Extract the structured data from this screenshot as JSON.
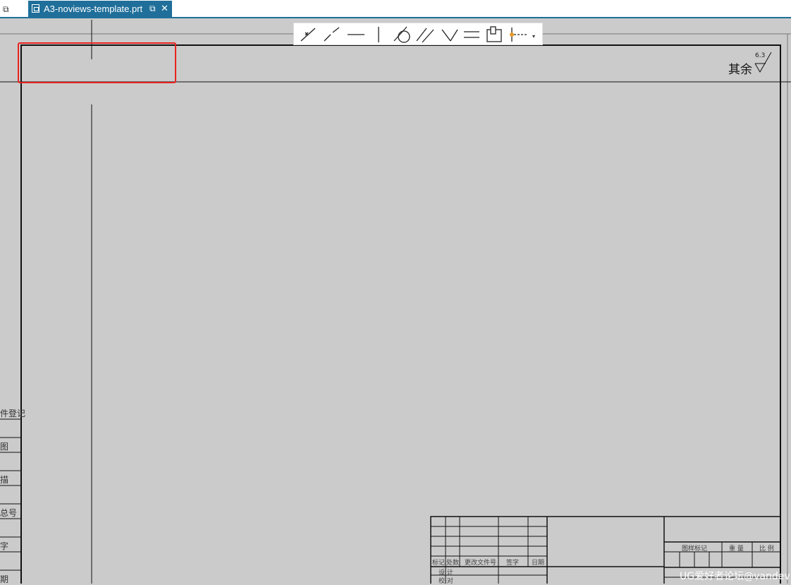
{
  "window": {
    "tab_title": "A3-noviews-template.prt"
  },
  "toolbar": {
    "tools": [
      {
        "name": "point-constraint-icon"
      },
      {
        "name": "point-on-curve-icon"
      },
      {
        "name": "horizontal-icon"
      },
      {
        "name": "vertical-icon"
      },
      {
        "name": "tangent-icon"
      },
      {
        "name": "parallel-icon"
      },
      {
        "name": "perpendicular-icon"
      },
      {
        "name": "equal-length-icon"
      },
      {
        "name": "fixed-icon"
      },
      {
        "name": "midpoint-icon"
      }
    ]
  },
  "drawing": {
    "roughness_prefix": "其余",
    "roughness_value": "6.3",
    "left_column_labels": [
      "件登记",
      "图",
      "描",
      "总号",
      "字",
      "期"
    ],
    "title_block": {
      "header_row": [
        "标记",
        "处数",
        "更改文件号",
        "签字",
        "日期"
      ],
      "row_design": "设 计",
      "row_check": "校 对",
      "drawing_mark": "图样标记",
      "weight": "重 量",
      "scale": "比 例"
    }
  },
  "watermark": "UG爱好者论坛@vandev"
}
